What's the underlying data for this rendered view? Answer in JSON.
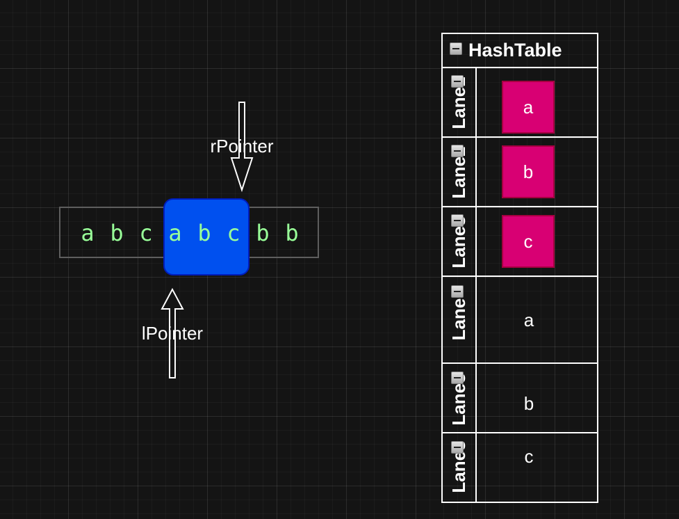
{
  "string": {
    "chars": [
      "a",
      "b",
      "c",
      "a",
      "b",
      "c",
      "b",
      "b"
    ]
  },
  "pointers": {
    "right": "rPointer",
    "left": "lPointer"
  },
  "hashtable": {
    "title": "HashTable",
    "lanes": [
      {
        "label": "Lane1",
        "value": "a",
        "boxed": true
      },
      {
        "label": "Lane2",
        "value": "b",
        "boxed": true
      },
      {
        "label": "Lane3",
        "value": "c",
        "boxed": true
      },
      {
        "label": "Lane",
        "value": "a",
        "boxed": false
      },
      {
        "label": "Lane3",
        "value": "b",
        "boxed": false
      },
      {
        "label": "Lane3",
        "value": "c",
        "boxed": false
      }
    ]
  },
  "colors": {
    "background": "#141414",
    "window_highlight": "#0050ef",
    "char_text": "#99ff99",
    "pink_box": "#d80073",
    "table_border": "#ffffff"
  }
}
